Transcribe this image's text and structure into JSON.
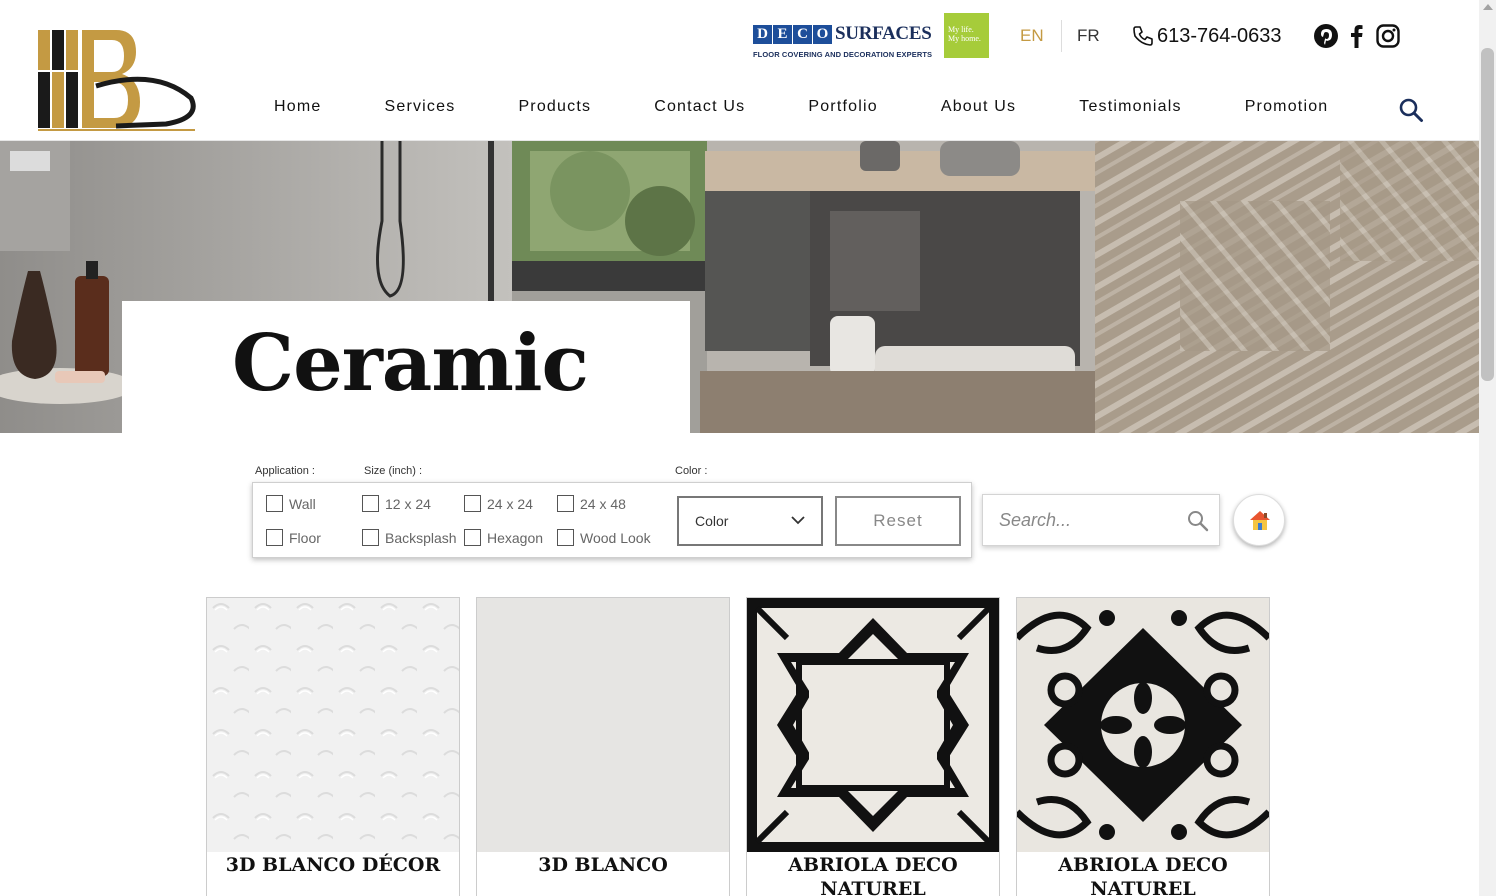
{
  "header": {
    "partner_boxes": [
      "D",
      "E",
      "C",
      "O"
    ],
    "partner_word": "SURFACES",
    "partner_tagline": "FLOOR COVERING AND DECORATION EXPERTS",
    "partner_badge": "My life. My home.",
    "lang_en": "EN",
    "lang_fr": "FR",
    "phone": "613-764-0633",
    "social_icons": [
      "pinterest-icon",
      "facebook-icon",
      "instagram-icon"
    ]
  },
  "nav": {
    "items": [
      "Home",
      "Services",
      "Products",
      "Contact Us",
      "Portfolio",
      "About Us",
      "Testimonials",
      "Promotion"
    ]
  },
  "hero": {
    "title": "Ceramic"
  },
  "filters": {
    "application_label": "Application :",
    "size_label": "Size (inch) :",
    "color_label": "Color :",
    "checkboxes": [
      "Wall",
      "Floor",
      "12 x 24",
      "Backsplash",
      "24 x 24",
      "Hexagon",
      "24 x 48",
      "Wood Look"
    ],
    "color_value": "Color",
    "reset_label": "Reset",
    "search_placeholder": "Search..."
  },
  "products": [
    {
      "name": "3D BLANCO DÉCOR"
    },
    {
      "name": "3D BLANCO"
    },
    {
      "name": "ABRIOLA DECO NATUREL"
    },
    {
      "name": "ABRIOLA DECO NATUREL"
    }
  ],
  "colors": {
    "accent_gold": "#c49a43",
    "logo_dark": "#1a1a1a",
    "deco_blue": "#1d4e9a",
    "badge_green": "#a6cc3a"
  }
}
